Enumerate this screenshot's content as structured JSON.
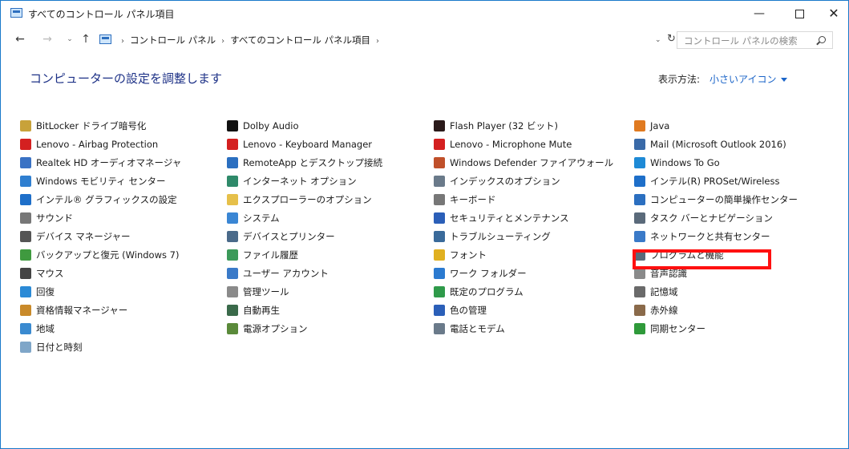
{
  "window": {
    "title": "すべてのコントロール パネル項目",
    "min": "—",
    "close": "✕"
  },
  "nav": {
    "back": "←",
    "forward": "→",
    "recent": "⌄",
    "up": "↑",
    "crumbs": [
      "コントロール パネル",
      "すべてのコントロール パネル項目"
    ],
    "crumb_sep": "›",
    "dropdown": "⌄",
    "refresh": "↻",
    "search_placeholder": "コントロール パネルの検索"
  },
  "header": {
    "title": "コンピューターの設定を調整します",
    "viewby_label": "表示方法:",
    "viewby_value": "小さいアイコン"
  },
  "columns": [
    [
      {
        "label": "BitLocker ドライブ暗号化",
        "icon": "bitlocker-icon",
        "color": "#c8a23a"
      },
      {
        "label": "Lenovo - Airbag Protection",
        "icon": "airbag-icon",
        "color": "#d42020"
      },
      {
        "label": "Realtek HD オーディオマネージャ",
        "icon": "realtek-icon",
        "color": "#3a72c4"
      },
      {
        "label": "Windows モビリティ センター",
        "icon": "mobility-icon",
        "color": "#2f7fd0"
      },
      {
        "label": "インテル® グラフィックスの設定",
        "icon": "intel-graphics-icon",
        "color": "#1e6fc9"
      },
      {
        "label": "サウンド",
        "icon": "sound-icon",
        "color": "#777777"
      },
      {
        "label": "デバイス マネージャー",
        "icon": "device-manager-icon",
        "color": "#555555"
      },
      {
        "label": "バックアップと復元 (Windows 7)",
        "icon": "backup-icon",
        "color": "#3f9a3f"
      },
      {
        "label": "マウス",
        "icon": "mouse-icon",
        "color": "#444444"
      },
      {
        "label": "回復",
        "icon": "recovery-icon",
        "color": "#2b8ad6"
      },
      {
        "label": "資格情報マネージャー",
        "icon": "credential-icon",
        "color": "#c98a2a"
      },
      {
        "label": "地域",
        "icon": "region-icon",
        "color": "#3a8ad0"
      },
      {
        "label": "日付と時刻",
        "icon": "date-time-icon",
        "color": "#7fa6c8"
      }
    ],
    [
      {
        "label": "Dolby Audio",
        "icon": "dolby-icon",
        "color": "#111111"
      },
      {
        "label": "Lenovo - Keyboard Manager",
        "icon": "keyboard-manager-icon",
        "color": "#d42020"
      },
      {
        "label": "RemoteApp とデスクトップ接続",
        "icon": "remoteapp-icon",
        "color": "#2b6fc0"
      },
      {
        "label": "インターネット オプション",
        "icon": "internet-options-icon",
        "color": "#2f8a6a"
      },
      {
        "label": "エクスプローラーのオプション",
        "icon": "explorer-options-icon",
        "color": "#e6c04a"
      },
      {
        "label": "システム",
        "icon": "system-icon",
        "color": "#3a86d4"
      },
      {
        "label": "デバイスとプリンター",
        "icon": "devices-printers-icon",
        "color": "#4a6a8a"
      },
      {
        "label": "ファイル履歴",
        "icon": "file-history-icon",
        "color": "#3c9a5a"
      },
      {
        "label": "ユーザー アカウント",
        "icon": "user-accounts-icon",
        "color": "#3a7ac8"
      },
      {
        "label": "管理ツール",
        "icon": "admin-tools-icon",
        "color": "#8a8a8a"
      },
      {
        "label": "自動再生",
        "icon": "autoplay-icon",
        "color": "#3a6a4a"
      },
      {
        "label": "電源オプション",
        "icon": "power-options-icon",
        "color": "#5a8a3a"
      }
    ],
    [
      {
        "label": "Flash Player (32 ビット)",
        "icon": "flash-icon",
        "color": "#2a1a1a"
      },
      {
        "label": "Lenovo - Microphone Mute",
        "icon": "microphone-mute-icon",
        "color": "#d42020"
      },
      {
        "label": "Windows Defender ファイアウォール",
        "icon": "firewall-icon",
        "color": "#c0502a"
      },
      {
        "label": "インデックスのオプション",
        "icon": "indexing-icon",
        "color": "#6a7a8a"
      },
      {
        "label": "キーボード",
        "icon": "keyboard-icon",
        "color": "#777777"
      },
      {
        "label": "セキュリティとメンテナンス",
        "icon": "security-flag-icon",
        "color": "#2b5fb8"
      },
      {
        "label": "トラブルシューティング",
        "icon": "troubleshoot-icon",
        "color": "#3a6a9a"
      },
      {
        "label": "フォント",
        "icon": "fonts-icon",
        "color": "#e0b020"
      },
      {
        "label": "ワーク フォルダー",
        "icon": "work-folders-icon",
        "color": "#2b7ad0"
      },
      {
        "label": "既定のプログラム",
        "icon": "default-programs-icon",
        "color": "#2f9a4a"
      },
      {
        "label": "色の管理",
        "icon": "color-management-icon",
        "color": "#2b5fb8"
      },
      {
        "label": "電話とモデム",
        "icon": "phone-modem-icon",
        "color": "#6a7a8a"
      }
    ],
    [
      {
        "label": "Java",
        "icon": "java-icon",
        "color": "#e07a20"
      },
      {
        "label": "Mail (Microsoft Outlook 2016)",
        "icon": "mail-icon",
        "color": "#3a6aa8"
      },
      {
        "label": "Windows To Go",
        "icon": "windows-to-go-icon",
        "color": "#1e8ad6"
      },
      {
        "label": "インテル(R) PROSet/Wireless",
        "icon": "wireless-icon",
        "color": "#1e6fc9"
      },
      {
        "label": "コンピューターの簡単操作センター",
        "icon": "ease-of-access-icon",
        "color": "#2b6fc0"
      },
      {
        "label": "タスク バーとナビゲーション",
        "icon": "taskbar-icon",
        "color": "#5a6a7a"
      },
      {
        "label": "ネットワークと共有センター",
        "icon": "network-icon",
        "color": "#3a7ac8"
      },
      {
        "label": "プログラムと機能",
        "icon": "programs-features-icon",
        "color": "#5a6a7a"
      },
      {
        "label": "音声認識",
        "icon": "speech-icon",
        "color": "#8a8a8a"
      },
      {
        "label": "記憶域",
        "icon": "storage-icon",
        "color": "#6a6a6a"
      },
      {
        "label": "赤外線",
        "icon": "infrared-icon",
        "color": "#8a6a4a"
      },
      {
        "label": "同期センター",
        "icon": "sync-center-icon",
        "color": "#2f9a3a"
      }
    ]
  ],
  "accent": "#1a64c8",
  "highlight_color": "#ff1010"
}
